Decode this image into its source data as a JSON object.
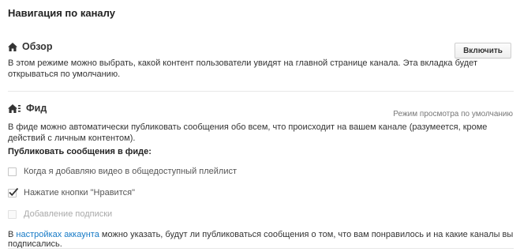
{
  "page_title": "Навигация по каналу",
  "overview": {
    "title": "Обзор",
    "icon": "home-icon",
    "enable_button": "Включить",
    "description": "В этом режиме можно выбрать, какой контент пользователи увидят на главной странице канала. Эта вкладка будет открываться по умолчанию."
  },
  "feed": {
    "title": "Фид",
    "icon": "home-feed-icon",
    "mode_label": "Режим просмотра по умолчанию",
    "description": "В фиде можно автоматически публиковать сообщения обо всем, что происходит на вашем канале (разумеется, кроме действий с личным контентом).",
    "publish_heading": "Публиковать сообщения в фиде:",
    "options": [
      {
        "label": "Когда я добавляю видео в общедоступный плейлист",
        "checked": false,
        "disabled": false
      },
      {
        "label": "Нажатие кнопки \"Нравится\"",
        "checked": true,
        "disabled": false
      },
      {
        "label": "Добавление подписки",
        "checked": false,
        "disabled": true
      }
    ]
  },
  "footer": {
    "prefix": "В ",
    "link_text": "настройках аккаунта",
    "suffix": " можно указать, будут ли публиковаться сообщения о том, что вам понравилось и на какие каналы вы подписались."
  },
  "colors": {
    "link": "#167ac6",
    "checkmark": "#333333"
  }
}
